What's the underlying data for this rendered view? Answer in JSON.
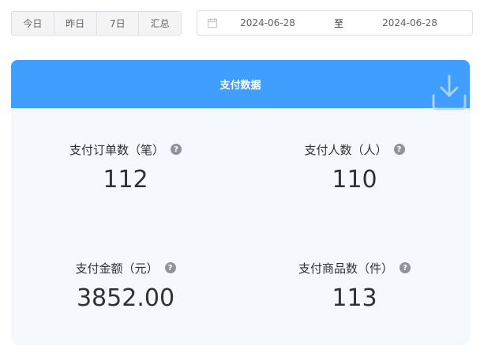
{
  "range_tabs": [
    "今日",
    "昨日",
    "7日",
    "汇总"
  ],
  "date_range": {
    "start": "2024-06-28",
    "separator": "至",
    "end": "2024-06-28"
  },
  "card": {
    "title": "支付数据",
    "stats": [
      {
        "label": "支付订单数（笔）",
        "value": "112"
      },
      {
        "label": "支付人数（人）",
        "value": "110"
      },
      {
        "label": "支付金额（元）",
        "value": "3852.00"
      },
      {
        "label": "支付商品数（件）",
        "value": "113"
      }
    ]
  },
  "icons": {
    "calendar": "calendar-icon",
    "download": "download-icon",
    "help": "help-icon"
  },
  "colors": {
    "accent": "#409eff",
    "card_bg": "#f5f8fd",
    "help_icon": "#909399"
  }
}
